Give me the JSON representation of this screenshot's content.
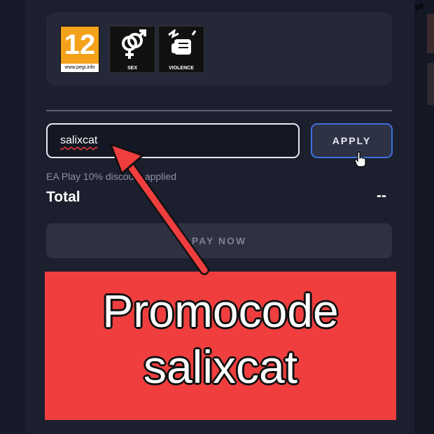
{
  "rating": {
    "age_rating": "12",
    "pegi_url": "www.pegi.info",
    "descriptors": [
      {
        "icon": "sex-icon",
        "label": "SEX"
      },
      {
        "icon": "violence-icon",
        "label": "VIOLENCE"
      }
    ]
  },
  "promo": {
    "input_value": "salixcat",
    "apply_label": "APPLY"
  },
  "discount_note": "EA Play 10% discount applied",
  "total": {
    "label": "Total",
    "value": "--"
  },
  "pay_label": "PAY NOW",
  "annotation": {
    "line1": "Promocode",
    "line2": "salixcat",
    "accent": "#f03e3f"
  },
  "colors": {
    "panel_bg": "#1c1f2e",
    "apply_border": "#3d6fe0"
  }
}
